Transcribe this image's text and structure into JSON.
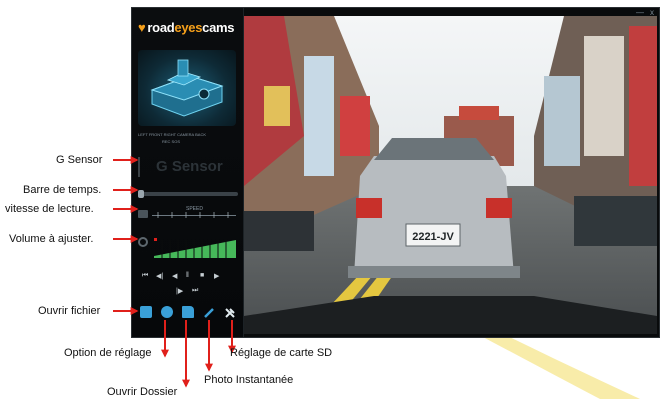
{
  "app": {
    "logo": {
      "part1": "road",
      "part2": "eyes",
      "part3": "cams"
    },
    "window_controls": {
      "minimize": "—",
      "close": "x"
    },
    "gsensor_label": "G Sensor",
    "speed_label": "SPEED",
    "device_legend": {
      "line1": "LEFT   FRONT   RIGHT   CAMERA   BACK",
      "line2": "REC   SOS"
    },
    "video": {
      "plate_text": "2221-JV"
    }
  },
  "player_controls": [
    "prev",
    "step-back",
    "play-back",
    "pause",
    "stop",
    "play",
    "slow",
    "next"
  ],
  "toolbar": [
    "open-file",
    "settings",
    "open-folder",
    "snapshot",
    "sd-settings"
  ],
  "callouts": {
    "gsensor": "G Sensor",
    "timebar": "Barre de temps.",
    "speed": "vitesse de lecture.",
    "volume": "Volume à ajuster.",
    "open_file": "Ouvrir fichier",
    "settings": "Option de réglage",
    "sd_settings": "Réglage de carte SD",
    "snapshot": "Photo Instantanée",
    "open_folder": "Ouvrir Dossier"
  },
  "colors": {
    "accent": "#f6a01a",
    "arrow": "#e0201b",
    "toolbar_blue": "#3aa0d8",
    "volume_green": "#46b85a",
    "watermark": "#f2d84a"
  }
}
